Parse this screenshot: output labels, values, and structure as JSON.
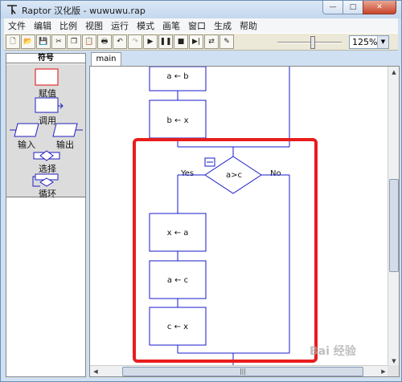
{
  "window": {
    "title": "Raptor 汉化版 - wuwuwu.rap",
    "controls": {
      "minimize": "—",
      "maximize": "□",
      "close": "✕"
    }
  },
  "menu": [
    "文件",
    "编辑",
    "比例",
    "视图",
    "运行",
    "模式",
    "画笔",
    "窗口",
    "生成",
    "帮助"
  ],
  "toolbar": {
    "buttons": [
      {
        "name": "new-file-icon",
        "glyph": "🗋",
        "enabled": true
      },
      {
        "name": "open-folder-icon",
        "glyph": "📂",
        "enabled": true
      },
      {
        "name": "save-icon",
        "glyph": "💾",
        "enabled": true
      },
      {
        "name": "cut-icon",
        "glyph": "✂",
        "enabled": true
      },
      {
        "name": "copy-icon",
        "glyph": "❐",
        "enabled": true
      },
      {
        "name": "paste-icon",
        "glyph": "📋",
        "enabled": true
      },
      {
        "name": "print-icon",
        "glyph": "🖶",
        "enabled": true
      },
      {
        "name": "undo-icon",
        "glyph": "↶",
        "enabled": true
      },
      {
        "name": "redo-icon",
        "glyph": "↷",
        "enabled": false
      },
      {
        "name": "play-icon",
        "glyph": "▶",
        "enabled": true
      },
      {
        "name": "pause-icon",
        "glyph": "❚❚",
        "enabled": true
      },
      {
        "name": "stop-icon",
        "glyph": "■",
        "enabled": true
      },
      {
        "name": "step-icon",
        "glyph": "▶|",
        "enabled": true
      },
      {
        "name": "test-server-icon",
        "glyph": "⇄",
        "enabled": true
      },
      {
        "name": "pen-icon",
        "glyph": "✎",
        "enabled": true
      }
    ],
    "zoom": "125%",
    "speed_level": 0.55
  },
  "symbols": {
    "header": "符号",
    "items": [
      "赋值",
      "调用",
      "输入",
      "输出",
      "选择",
      "循环"
    ]
  },
  "tabs": [
    "main"
  ],
  "flowchart": {
    "assign_top1": "a ← b",
    "assign_top2": "b ← x",
    "condition": "a>c",
    "yes": "Yes",
    "no": "No",
    "assign_1": "x ← a",
    "assign_2": "a ← c",
    "assign_3": "c ← x"
  },
  "scrollbar": {
    "grip": "|||"
  },
  "watermark": "Bai 经验",
  "colors": {
    "highlight": "#e81d1d",
    "flow_lines": "#1a1acc",
    "selected_symbol": "#e03030"
  }
}
